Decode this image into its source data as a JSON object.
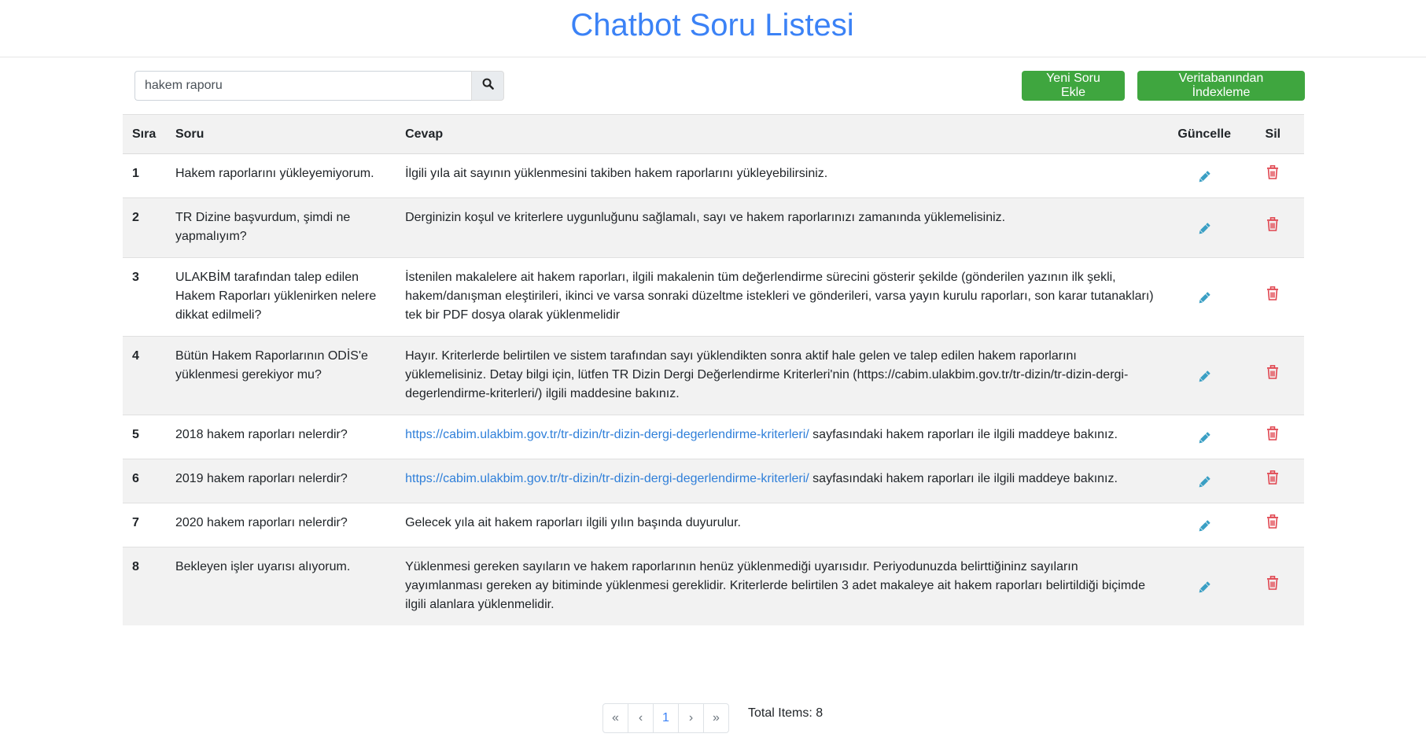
{
  "page": {
    "title": "Chatbot Soru Listesi"
  },
  "search": {
    "value": "hakem raporu",
    "placeholder": ""
  },
  "toolbar": {
    "new_label": "Yeni Soru Ekle",
    "index_label": "Veritabanından İndexleme"
  },
  "table": {
    "headers": {
      "sira": "Sıra",
      "soru": "Soru",
      "cevap": "Cevap",
      "guncelle": "Güncelle",
      "sil": "Sil"
    },
    "rows": [
      {
        "sira": "1",
        "soru": "Hakem raporlarını yükleyemiyorum.",
        "cevap": "İlgili yıla ait sayının yüklenmesini takiben hakem raporlarını yükleyebilirsiniz.",
        "link": "",
        "after_link": ""
      },
      {
        "sira": "2",
        "soru": "TR Dizine başvurdum, şimdi ne yapmalıyım?",
        "cevap": "Derginizin koşul ve kriterlere uygunluğunu sağlamalı, sayı ve hakem raporlarınızı zamanında yüklemelisiniz.",
        "link": "",
        "after_link": ""
      },
      {
        "sira": "3",
        "soru": "ULAKBİM tarafından talep edilen Hakem Raporları yüklenirken nelere dikkat edilmeli?",
        "cevap": "İstenilen makalelere ait hakem raporları, ilgili makalenin tüm değerlendirme sürecini gösterir şekilde (gönderilen yazının ilk şekli, hakem/danışman eleştirileri, ikinci ve varsa sonraki düzeltme istekleri ve gönderileri, varsa yayın kurulu raporları, son karar tutanakları) tek bir PDF dosya olarak yüklenmelidir",
        "link": "",
        "after_link": ""
      },
      {
        "sira": "4",
        "soru": "Bütün Hakem Raporlarının ODİS'e yüklenmesi gerekiyor mu?",
        "cevap": "Hayır. Kriterlerde belirtilen ve sistem tarafından sayı yüklendikten sonra aktif hale gelen ve talep edilen hakem raporlarını yüklemelisiniz. Detay bilgi için, lütfen TR Dizin Dergi Değerlendirme Kriterleri'nin (https://cabim.ulakbim.gov.tr/tr-dizin/tr-dizin-dergi-degerlendirme-kriterleri/) ilgili maddesine bakınız.",
        "link": "",
        "after_link": ""
      },
      {
        "sira": "5",
        "soru": "2018 hakem raporları nelerdir?",
        "cevap": "",
        "link": "https://cabim.ulakbim.gov.tr/tr-dizin/tr-dizin-dergi-degerlendirme-kriterleri/",
        "after_link": " sayfasındaki hakem raporları ile ilgili maddeye bakınız."
      },
      {
        "sira": "6",
        "soru": "2019 hakem raporları nelerdir?",
        "cevap": "",
        "link": "https://cabim.ulakbim.gov.tr/tr-dizin/tr-dizin-dergi-degerlendirme-kriterleri/",
        "after_link": " sayfasındaki hakem raporları ile ilgili maddeye bakınız."
      },
      {
        "sira": "7",
        "soru": "2020 hakem raporları nelerdir?",
        "cevap": "Gelecek yıla ait hakem raporları ilgili yılın başında duyurulur.",
        "link": "",
        "after_link": ""
      },
      {
        "sira": "8",
        "soru": "Bekleyen işler uyarısı alıyorum.",
        "cevap": "Yüklenmesi gereken sayıların ve hakem raporlarının henüz yüklenmediği uyarısıdır. Periyodunuzda belirttiğininz sayıların yayımlanması gereken ay bitiminde yüklenmesi gereklidir. Kriterlerde belirtilen 3 adet makaleye ait hakem raporları belirtildiği biçimde ilgili alanlara yüklenmelidir.",
        "link": "",
        "after_link": ""
      }
    ]
  },
  "pagination": {
    "first": "«",
    "prev": "‹",
    "current": "1",
    "next": "›",
    "last": "»"
  },
  "total": {
    "label": "Total Items: 8"
  },
  "colors": {
    "accent": "#3b82f6",
    "green": "#3fa63f",
    "edit": "#3a9fc4",
    "delete": "#e0454f",
    "link": "#2f7fd9"
  },
  "icons": {
    "search": "search-icon",
    "edit": "pencil-icon",
    "delete": "trash-icon"
  }
}
